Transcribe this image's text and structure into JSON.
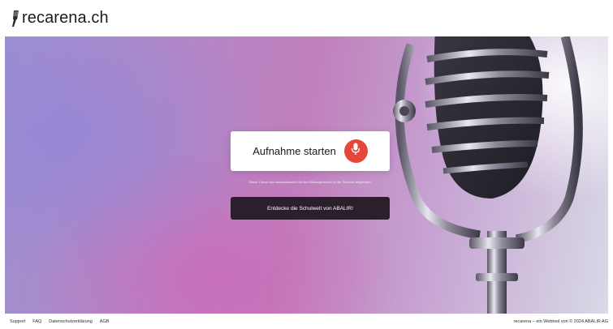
{
  "header": {
    "brand": "recarena.ch",
    "logo_icon": "microphone-icon"
  },
  "hero": {
    "record_label": "Aufnahme starten",
    "record_icon": "microphone-icon",
    "record_color": "#e5483a",
    "note": "Dieser Dienst wird ausschliesslich für den Bildungsbereich in der Schweiz angeboten.",
    "discover_label": "Entdecke die Schulwelt von ABALIR!"
  },
  "footer": {
    "links": [
      "Support",
      "FAQ",
      "Datenschutzerklärung",
      "AGB"
    ],
    "credit": "recarena – ein Webtool von © 2024 ABALIR AG"
  }
}
